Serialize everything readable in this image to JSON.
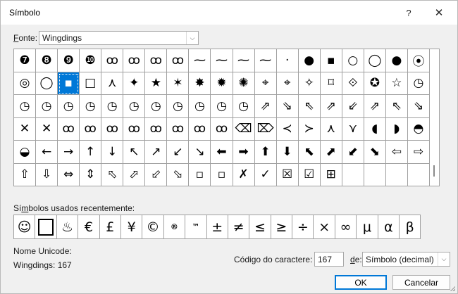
{
  "window": {
    "title": "Símbolo",
    "help_glyph": "?",
    "close_glyph": "✕"
  },
  "font": {
    "label_underlined": "F",
    "label_rest": "onte:",
    "value": "Wingdings",
    "arrow_glyph": "⌵"
  },
  "symbol_grid": {
    "rows": [
      [
        "❼",
        "❽",
        "❾",
        "❿",
        "ꝏ",
        "ꝏ",
        "ꝏ",
        "ꝏ",
        "⁓",
        "⁓",
        "⁓",
        "⁓",
        "·",
        "●",
        "▪",
        "○",
        "◯",
        "●",
        "⦿"
      ],
      [
        "◎",
        "◯",
        "▪",
        "□",
        "⋏",
        "✦",
        "★",
        "✶",
        "✸",
        "✹",
        "✺",
        "⌖",
        "⌖",
        "✧",
        "⌑",
        "⟐",
        "✪",
        "☆",
        "◷"
      ],
      [
        "◷",
        "◷",
        "◷",
        "◷",
        "◷",
        "◷",
        "◷",
        "◷",
        "◷",
        "◷",
        "◷",
        "⇗",
        "⇘",
        "⇖",
        "⇗",
        "⇙",
        "⇗",
        "⇖",
        "⇘"
      ],
      [
        "✕",
        "✕",
        "ꝏ",
        "ꝏ",
        "ꝏ",
        "ꝏ",
        "ꝏ",
        "ꝏ",
        "ꝏ",
        "ꝏ",
        "⌫",
        "⌦",
        "≺",
        "≻",
        "⋏",
        "⋎",
        "◖",
        "◗",
        "◓"
      ],
      [
        "◒",
        "←",
        "→",
        "↑",
        "↓",
        "↖",
        "↗",
        "↙",
        "↘",
        "⬅",
        "➡",
        "⬆",
        "⬇",
        "⬉",
        "⬈",
        "⬋",
        "⬊",
        "⇦",
        "⇨"
      ],
      [
        "⇧",
        "⇩",
        "⇔",
        "⇕",
        "⬁",
        "⬀",
        "⬃",
        "⬂",
        "▫",
        "▫",
        "✗",
        "✓",
        "☒",
        "☑",
        "⊞",
        "",
        "",
        "",
        ""
      ]
    ],
    "selected_row": 1,
    "selected_col": 2
  },
  "recent": {
    "label_before": "Sí",
    "label_underlined": "m",
    "label_after": "bolos usados recentemente:",
    "items": [
      "☺",
      "",
      "♨",
      "€",
      "£",
      "¥",
      "©",
      "®",
      "™",
      "±",
      "≠",
      "≤",
      "≥",
      "÷",
      "×",
      "∞",
      "μ",
      "α",
      "β"
    ]
  },
  "unicode": {
    "label": "Nome Unicode:",
    "value": "Wingdings: 167"
  },
  "char_code": {
    "label_before": "Códi",
    "label_underlined": "g",
    "label_after": "o do caractere:",
    "value": "167"
  },
  "from": {
    "label_underlined": "d",
    "label_rest": "e:",
    "value": "Símbolo (decimal)",
    "arrow_glyph": "⌵"
  },
  "buttons": {
    "ok": "OK",
    "cancel": "Cancelar"
  }
}
